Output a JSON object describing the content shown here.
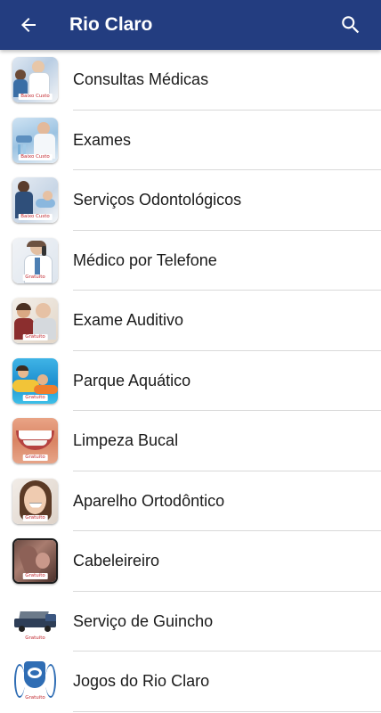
{
  "app_bar": {
    "title": "Rio Claro",
    "background": "#233d80",
    "back_icon": "arrow-back-icon",
    "search_icon": "search-icon"
  },
  "items": [
    {
      "label": "Consultas Médicas",
      "badge": "Baixo Custo",
      "icon": "doctor-consultation-photo"
    },
    {
      "label": "Exames",
      "badge": "Baixo Custo",
      "icon": "lab-exams-photo"
    },
    {
      "label": "Serviços Odontológicos",
      "badge": "Baixo Custo",
      "icon": "dentist-photo"
    },
    {
      "label": "Médico por Telefone",
      "badge": "Gratuito",
      "icon": "doctor-phone-photo"
    },
    {
      "label": "Exame Auditivo",
      "badge": "Gratuito",
      "icon": "hearing-exam-photo"
    },
    {
      "label": "Parque Aquático",
      "badge": "Gratuito",
      "icon": "water-park-photo"
    },
    {
      "label": "Limpeza Bucal",
      "badge": "Gratuito",
      "icon": "teeth-smile-photo"
    },
    {
      "label": "Aparelho Ortodôntico",
      "badge": "Gratuito",
      "icon": "braces-smile-photo"
    },
    {
      "label": "Cabeleireiro",
      "badge": "Gratuito",
      "icon": "hairdresser-photo"
    },
    {
      "label": "Serviço de Guincho",
      "badge": "Gratuito",
      "icon": "tow-truck-photo"
    },
    {
      "label": "Jogos do Rio Claro",
      "badge": "Gratuito",
      "icon": "club-crest-photo"
    }
  ]
}
